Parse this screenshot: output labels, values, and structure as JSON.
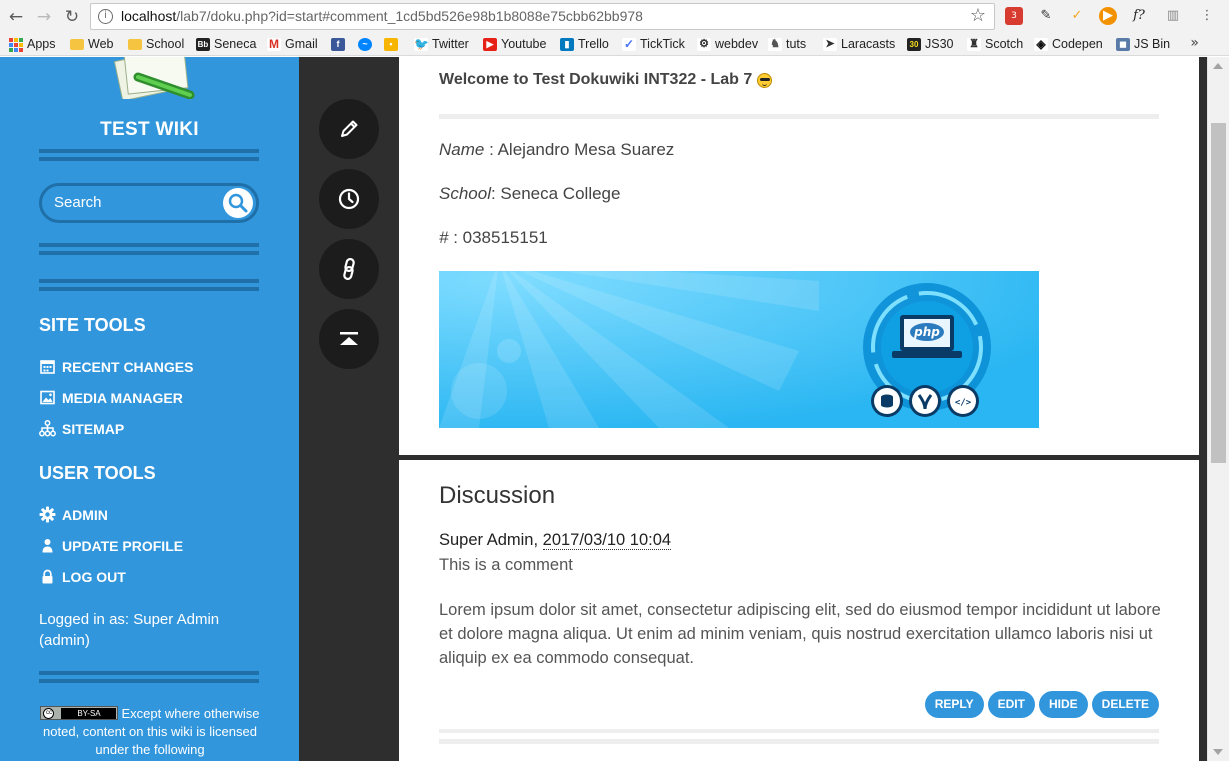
{
  "browser": {
    "url_host": "localhost",
    "url_path": "/lab7/doku.php?id=start#comment_1cd5bd526e98b1b8088e75cbb62bb978",
    "extension_badge": "3",
    "bookmarks": [
      {
        "label": "Apps",
        "icon": "apps-grid-icon"
      },
      {
        "label": "Web",
        "icon": "folder-icon"
      },
      {
        "label": "School",
        "icon": "folder-icon"
      },
      {
        "label": "Seneca",
        "icon": "blackboard-icon"
      },
      {
        "label": "Gmail",
        "icon": "gmail-icon"
      },
      {
        "label": "",
        "icon": "facebook-icon"
      },
      {
        "label": "",
        "icon": "messenger-icon"
      },
      {
        "label": "",
        "icon": "keep-icon"
      },
      {
        "label": "Twitter",
        "icon": "twitter-icon"
      },
      {
        "label": "Youtube",
        "icon": "youtube-icon"
      },
      {
        "label": "Trello",
        "icon": "trello-icon"
      },
      {
        "label": "TickTick",
        "icon": "ticktick-icon"
      },
      {
        "label": "webdev",
        "icon": "webdev-icon"
      },
      {
        "label": "tuts",
        "icon": "tuts-icon"
      },
      {
        "label": "Laracasts",
        "icon": "laracasts-icon"
      },
      {
        "label": "JS30",
        "icon": "js30-icon"
      },
      {
        "label": "Scotch",
        "icon": "scotch-icon"
      },
      {
        "label": "Codepen",
        "icon": "codepen-icon"
      },
      {
        "label": "JS Bin",
        "icon": "jsbin-icon"
      }
    ],
    "more": "»"
  },
  "sidebar": {
    "title": "TEST WIKI",
    "search_placeholder": "Search",
    "site_tools_title": "SITE TOOLS",
    "site_tools": [
      {
        "label": "RECENT CHANGES",
        "icon": "calendar-icon"
      },
      {
        "label": "MEDIA MANAGER",
        "icon": "image-icon"
      },
      {
        "label": "SITEMAP",
        "icon": "sitemap-icon"
      }
    ],
    "user_tools_title": "USER TOOLS",
    "user_tools": [
      {
        "label": "ADMIN",
        "icon": "gear-icon"
      },
      {
        "label": "UPDATE PROFILE",
        "icon": "user-icon"
      },
      {
        "label": "LOG OUT",
        "icon": "lock-icon"
      }
    ],
    "logged_in": "Logged in as: Super Admin (admin)",
    "license_badge": "BY-SA",
    "license_text": "Except where otherwise noted, content on this wiki is licensed under the following"
  },
  "pagetools": [
    {
      "name": "edit",
      "icon": "pencil-icon"
    },
    {
      "name": "revisions",
      "icon": "clock-icon"
    },
    {
      "name": "backlinks",
      "icon": "link-icon"
    },
    {
      "name": "back-to-top",
      "icon": "arrow-top-icon"
    }
  ],
  "content": {
    "welcome": "Welcome to Test Dokuwiki INT322 - Lab 7",
    "name_label": "Name",
    "name_value": " : Alejandro Mesa Suarez",
    "school_label": "School",
    "school_value": ": Seneca College",
    "number_label": "#",
    "number_value": " : 038515151",
    "banner_logo_text": "php",
    "banner_code_glyph": "</>"
  },
  "discussion": {
    "title": "Discussion",
    "author": "Super Admin, ",
    "date": "2017/03/10 10:04",
    "comment": "This is a comment",
    "body": "Lorem ipsum dolor sit amet, consectetur adipiscing elit, sed do eiusmod tempor incididunt ut labore et dolore magna aliqua. Ut enim ad minim veniam, quis nostrud exercitation ullamco laboris nisi ut aliquip ex ea commodo consequat.",
    "actions": [
      "REPLY",
      "EDIT",
      "HIDE",
      "DELETE"
    ]
  },
  "colors": {
    "sidebar_bg": "#3296dc",
    "sidebar_line": "#1f6fa8",
    "pagetools_bg": "#2e2e2e",
    "button": "#3296dc"
  }
}
